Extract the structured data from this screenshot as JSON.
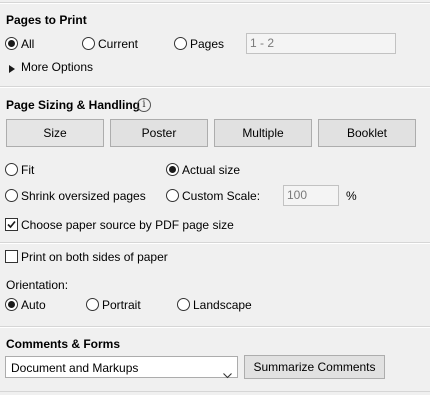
{
  "pages_to_print": {
    "title": "Pages to Print",
    "options": [
      "All",
      "Current",
      "Pages"
    ],
    "selected": "All",
    "pages_range": "1 - 2",
    "more_options": "More Options"
  },
  "page_sizing": {
    "title": "Page Sizing & Handling",
    "buttons": [
      "Size",
      "Poster",
      "Multiple",
      "Booklet"
    ],
    "fit": "Fit",
    "actual_size": "Actual size",
    "shrink": "Shrink oversized pages",
    "custom_scale": "Custom Scale:",
    "scale_value": "100",
    "percent": "%",
    "selected": "Actual size",
    "paper_source": "Choose paper source by PDF page size",
    "paper_source_checked": true
  },
  "duplex": {
    "label": "Print on both sides of paper",
    "checked": false
  },
  "orientation": {
    "label": "Orientation:",
    "options": [
      "Auto",
      "Portrait",
      "Landscape"
    ],
    "selected": "Auto"
  },
  "comments_forms": {
    "title": "Comments & Forms",
    "selected": "Document and Markups",
    "summarize_button": "Summarize Comments"
  }
}
